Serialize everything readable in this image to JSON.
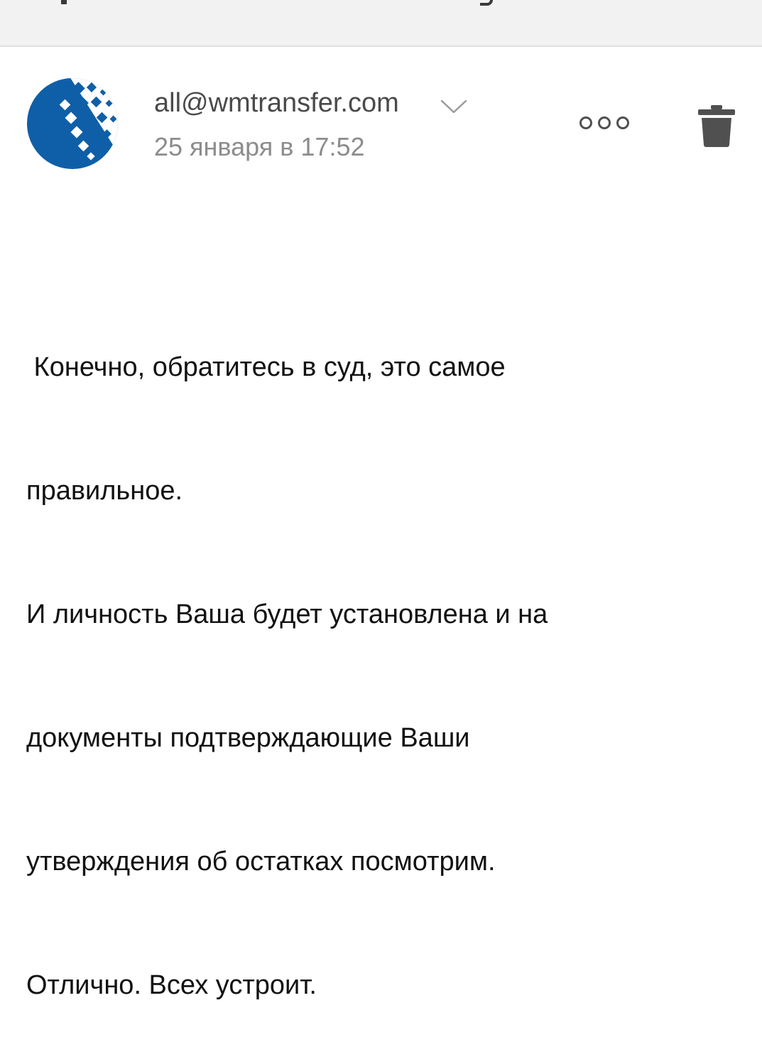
{
  "email": {
    "sender": "all@wmtransfer.com",
    "date": "25 января в 17:52",
    "avatar_icon": "webmoney-globe-logo",
    "actions": {
      "more_icon": "more-options-icon",
      "delete_icon": "trash-icon"
    },
    "body_lines": [
      " Конечно, обратитесь в суд, это самое",
      "правильное.",
      "И личность Ваша будет установлена и на",
      "документы подтверждающие Ваши",
      "утверждения об остатках посмотрим.",
      "Отлично. Всех устроит."
    ]
  },
  "colors": {
    "brand_blue": "#0f5fa8",
    "sender_text": "#4a4a4a",
    "date_text": "#8c8c8c",
    "icon_gray": "#505050",
    "top_bar_bg": "#f2f2f2"
  }
}
